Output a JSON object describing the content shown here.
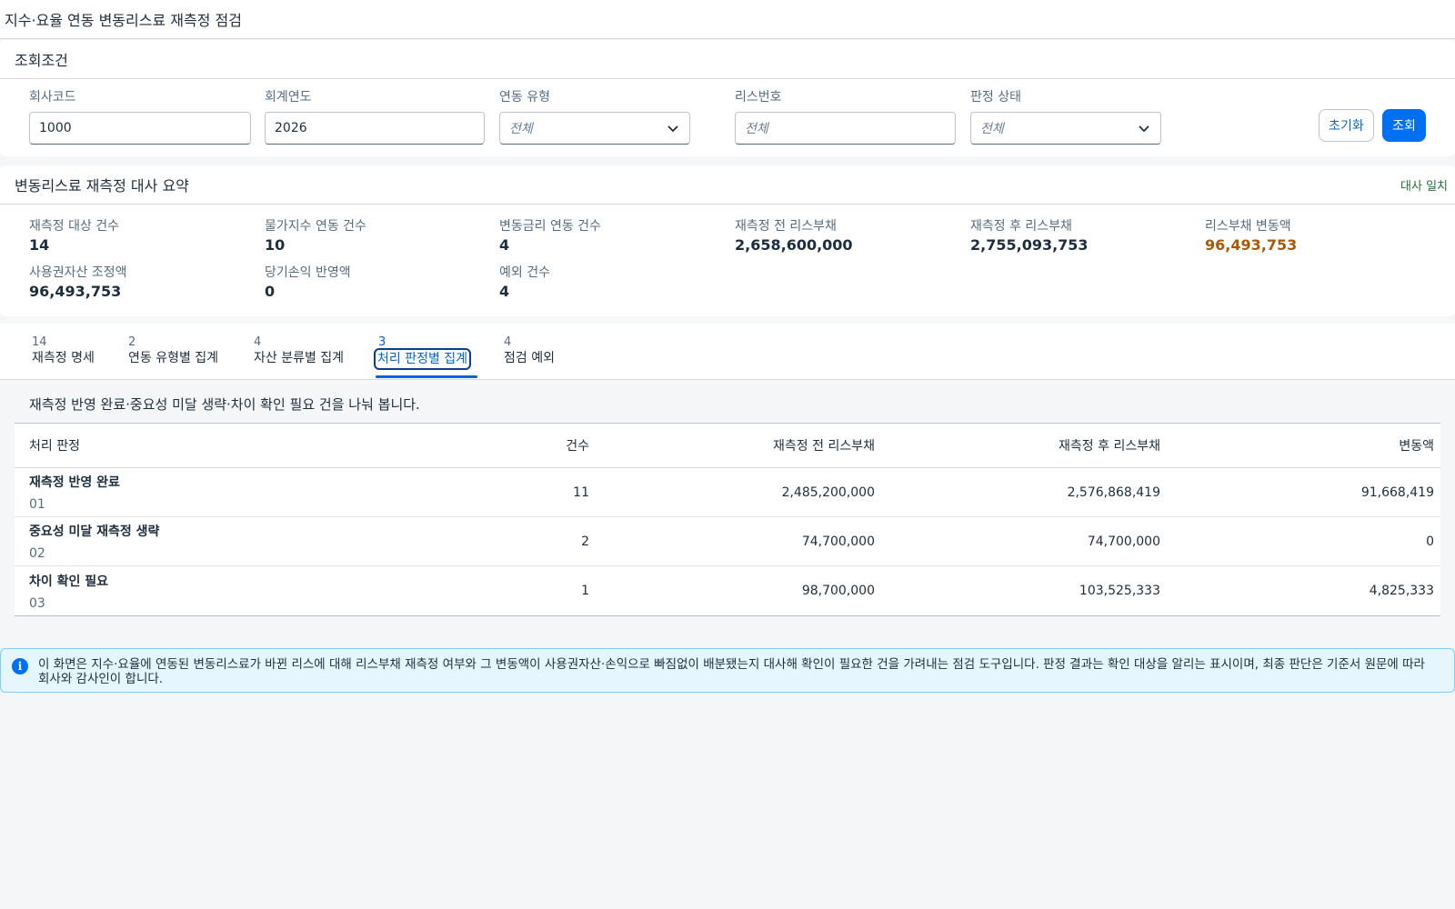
{
  "page": {
    "title": "지수·요율 연동 변동리스료 재측정 점검"
  },
  "filter": {
    "title": "조회조건",
    "fields": [
      {
        "label": "회사코드",
        "value": "1000"
      },
      {
        "label": "회계연도",
        "value": "2026"
      },
      {
        "label": "연동 유형",
        "value": "전체"
      },
      {
        "label": "리스번호",
        "placeholder": "전체"
      },
      {
        "label": "판정 상태",
        "value": "전체"
      }
    ],
    "reset_label": "초기화",
    "search_label": "조회"
  },
  "summary": {
    "title": "변동리스료 재측정 대사 요약",
    "status": "대사 일치",
    "status_color": "#256f3a",
    "kpis": [
      {
        "label": "재측정 대상 건수",
        "value": "14"
      },
      {
        "label": "물가지수 연동 건수",
        "value": "10"
      },
      {
        "label": "변동금리 연동 건수",
        "value": "4"
      },
      {
        "label": "재측정 전 리스부채",
        "value": "2,658,600,000"
      },
      {
        "label": "재측정 후 리스부채",
        "value": "2,755,093,753"
      },
      {
        "label": "리스부채 변동액",
        "value": "96,493,753"
      },
      {
        "label": "사용권자산 조정액",
        "value": "96,493,753"
      },
      {
        "label": "당기손익 반영액",
        "value": "0"
      },
      {
        "label": "예외 건수",
        "value": "4"
      }
    ]
  },
  "tabs": [
    {
      "count": "14",
      "label": "재측정 명세"
    },
    {
      "count": "2",
      "label": "연동 유형별 집계"
    },
    {
      "count": "4",
      "label": "자산 분류별 집계"
    },
    {
      "count": "3",
      "label": "처리 판정별 집계"
    },
    {
      "count": "4",
      "label": "점검 예외"
    }
  ],
  "content": {
    "description": "재측정 반영 완료·중요성 미달 생략·차이 확인 필요 건을 나눠 봅니다.",
    "columns": [
      "처리 판정",
      "건수",
      "재측정 전 리스부채",
      "재측정 후 리스부채",
      "변동액"
    ],
    "rows": [
      {
        "name": "재측정 반영 완료",
        "code": "01",
        "count": "11",
        "before": "2,485,200,000",
        "after": "2,576,868,419",
        "change": "91,668,419"
      },
      {
        "name": "중요성 미달 재측정 생략",
        "code": "02",
        "count": "2",
        "before": "74,700,000",
        "after": "74,700,000",
        "change": "0"
      },
      {
        "name": "차이 확인 필요",
        "code": "03",
        "count": "1",
        "before": "98,700,000",
        "after": "103,525,333",
        "change": "4,825,333"
      }
    ]
  },
  "info": {
    "icon": "info-icon",
    "text": "이 화면은 지수·요율에 연동된 변동리스료가 바뀐 리스에 대해 리스부채 재측정 여부와 그 변동액이 사용권자산·손익으로 빠짐없이 배분됐는지 대사해 확인이 필요한 건을 가려내는 점검 도구입니다. 판정 결과는 확인 대상을 알리는 표시이며, 최종 판단은 기준서 원문에 따라 회사와 감사인이 합니다."
  },
  "colors": {
    "accent": "#0070f2",
    "warning": "#aa5808",
    "info_bg": "#e5f6ff"
  }
}
